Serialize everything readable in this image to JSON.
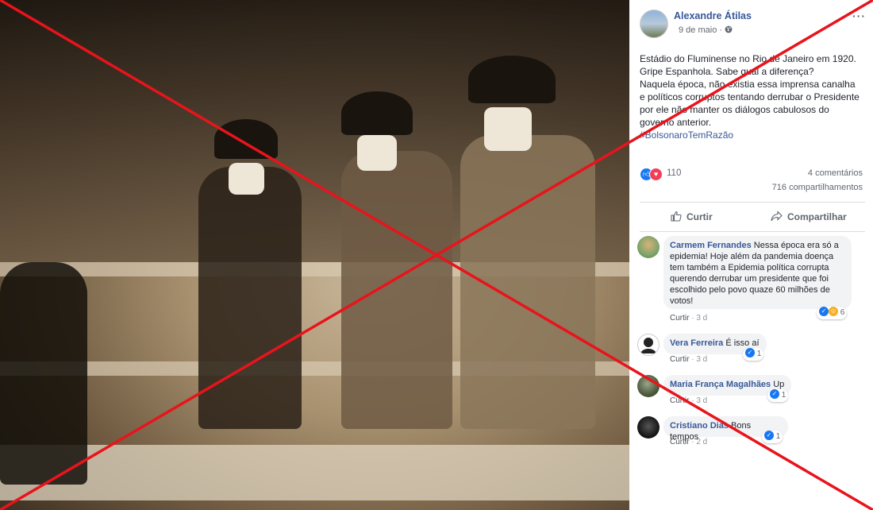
{
  "post": {
    "author": "Alexandre Átilas",
    "date": "9 de maio",
    "privacy_icon": "globe-icon",
    "text_lines": [
      "Estádio do Fluminense no Rio de Janeiro em 1920.",
      "Gripe Espanhola. Sabe qual a diferença?",
      "Naquela época, não existia essa imprensa canalha",
      "e políticos corruptos tentando derrubar o Presidente",
      "por ele não manter os diálogos cabulosos do",
      "governo anterior."
    ],
    "hashtag": "#BolsonaroTemRazão",
    "reaction_count": "110",
    "comments_count": "4 comentários",
    "shares_count": "716 compartilhamentos",
    "like_label": "Curtir",
    "share_label": "Compartilhar",
    "more_label": "···"
  },
  "comments": [
    {
      "name": "Carmem Fernandes",
      "text": "Nessa época era só a epidemia! Hoje além da pandemia doença tem também a Epidemia política corrupta querendo derrubar um presidente que foi escolhido pelo povo quaze 60 milhões de votos!",
      "like_label": "Curtir",
      "age": "3 d",
      "reactions": "6"
    },
    {
      "name": "Vera Ferreira",
      "text": "É isso aí",
      "like_label": "Curtir",
      "age": "3 d",
      "reactions": "1"
    },
    {
      "name": "Maria França Magalhães",
      "text": "Up",
      "like_label": "Curtir",
      "age": "3 d",
      "reactions": "1"
    },
    {
      "name": "Cristiano Dias",
      "text": "Bons tempos",
      "like_label": "Curtir",
      "age": "2 d",
      "reactions": "1"
    }
  ],
  "colors": {
    "link": "#385898",
    "cross": "#e8141c",
    "like": "#1877f2",
    "love": "#f33e58"
  }
}
